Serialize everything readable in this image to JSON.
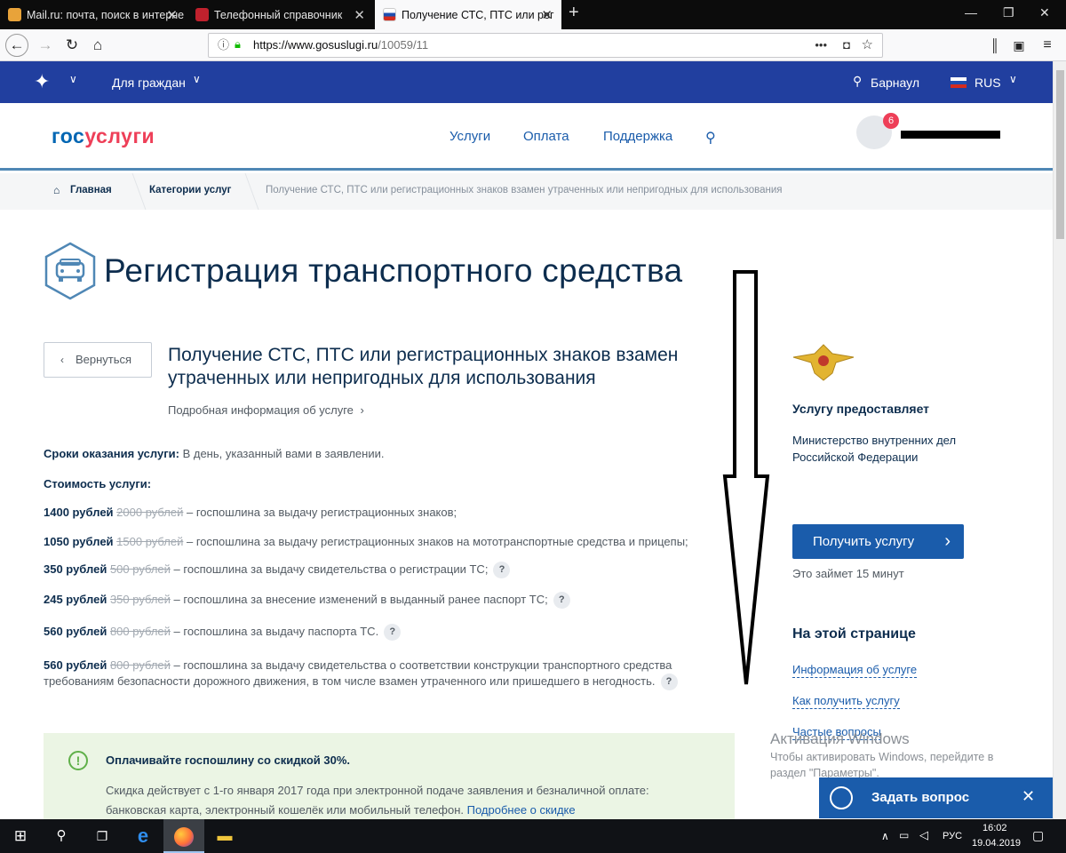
{
  "browser": {
    "tabs": [
      {
        "label": "Mail.ru: почта, поиск в интерне",
        "close": "✕"
      },
      {
        "label": "Телефонный справочник",
        "close": "✕"
      },
      {
        "label": "Получение СТС, ПТС или рег",
        "close": "✕"
      }
    ],
    "url": "https://www.gosuslugi.ru/10059/11",
    "url_host": "https://www.gosuslugi.ru",
    "url_path": "/10059/11",
    "url_more": "•••"
  },
  "topbar": {
    "citizens": "Для граждан",
    "city": "Барнаул",
    "lang": "RUS"
  },
  "header": {
    "logo_a": "гос",
    "logo_b": "услуги",
    "nav": [
      "Услуги",
      "Оплата",
      "Поддержка"
    ],
    "badge": "6"
  },
  "breadcrumbs": [
    "Главная",
    "Категории услуг",
    "Получение СТС, ПТС или регистрационных знаков взамен утраченных или непригодных для использования"
  ],
  "page": {
    "title": "Регистрация транспортного средства",
    "back": "Вернуться",
    "service_title": "Получение СТС, ПТС или регистрационных знаков взамен утраченных или непригодных для использования",
    "more_info": "Подробная информация об услуге",
    "terms_label": "Сроки оказания услуги:",
    "terms_value": " В день, указанный вами в заявлении.",
    "cost_label": "Стоимость услуги:",
    "costs": [
      {
        "price": "1400 рублей",
        "old": "2000 рублей",
        "desc": " – госпошлина за выдачу регистрационных знаков;",
        "help": false
      },
      {
        "price": "1050 рублей",
        "old": "1500 рублей",
        "desc": " – госпошлина за выдачу регистрационных знаков на мототранспортные средства и прицепы;",
        "help": false
      },
      {
        "price": "350 рублей",
        "old": "500 рублей",
        "desc": " – госпошлина за выдачу свидетельства о регистрации ТС;",
        "help": true
      },
      {
        "price": "245 рублей",
        "old": "350 рублей",
        "desc": " – госпошлина за внесение изменений в выданный ранее паспорт ТС;",
        "help": true
      },
      {
        "price": "560 рублей",
        "old": "800 рублей",
        "desc": " – госпошлина за выдачу паспорта ТС.",
        "help": true
      },
      {
        "price": "560 рублей",
        "old": "800 рублей",
        "desc": " – госпошлина за выдачу свидетельства о соответствии конструкции транспортного средства",
        "help": false
      }
    ],
    "cost_last_line2": "требованиям безопасности дорожного движения, в том числе взамен утраченного или пришедшего в негодность.",
    "help_glyph": "?",
    "note_title": "Оплачивайте госпошлину со скидкой 30%.",
    "note_text": "Скидка действует с 1-го января 2017 года при электронной подаче заявления и безналичной оплате:",
    "note_text2": "банковская карта, электронный кошелёк или мобильный телефон. ",
    "note_link": "Подробнее о скидке",
    "note_icon": "!"
  },
  "sidebar": {
    "provider_label": "Услугу предоставляет",
    "provider_line1": "Министерство внутренних дел",
    "provider_line2": "Российской Федерации",
    "get_button": "Получить услугу",
    "duration": "Это займет 15 минут",
    "on_page": "На этой странице",
    "links": [
      "Информация об услуге",
      "Как получить услугу",
      "Частые вопросы"
    ]
  },
  "watermark": {
    "line1": "Активация Windows",
    "line2": "Чтобы активировать Windows, перейдите в",
    "line3": "раздел \"Параметры\"."
  },
  "ask": {
    "label": "Задать вопрос",
    "close": "✕"
  },
  "taskbar": {
    "lang": "РУС",
    "time": "16:02",
    "date": "19.04.2019"
  }
}
